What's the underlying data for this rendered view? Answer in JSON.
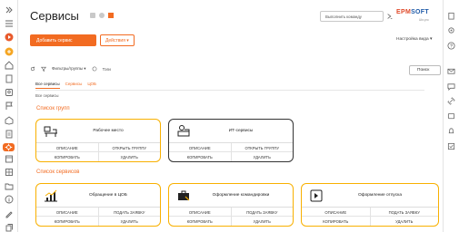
{
  "app": {
    "title": "Сервисы"
  },
  "header": {
    "command_placeholder": "Выполнить команду",
    "logo_main": "EPM",
    "logo_soft": "SOFT",
    "logo_sub": "Ukr-pro"
  },
  "actions": {
    "add_label": "Добавить сервис",
    "actions_label": "Действия ▾",
    "view_label": "Настройка вида ▾"
  },
  "toolbar": {
    "filters_label": "Фильтры/группы ▾",
    "tag_label": "Тэги",
    "search_label": "Поиск"
  },
  "tabs": [
    {
      "label": "Все сервисы",
      "active": true
    },
    {
      "label": "Сервисы",
      "active": false
    },
    {
      "label": "ЦОБ",
      "active": false
    }
  ],
  "breadcrumb": "Все сервисы",
  "sections": {
    "groups": "Список групп",
    "services": "Список сервисов"
  },
  "group_cards": [
    {
      "title": "Рабочее место",
      "icon": "desk-icon",
      "actions": [
        "ОПИСАНИЕ",
        "ОТКРЫТЬ ГРУППУ",
        "КОПИРОВАТЬ",
        "УДАЛИТЬ"
      ]
    },
    {
      "title": "ИТ-сервисы",
      "icon": "it-worker-icon",
      "actions": [
        "ОПИСАНИЕ",
        "ОТКРЫТЬ ГРУППУ",
        "КОПИРОВАТЬ",
        "УДАЛИТЬ"
      ]
    }
  ],
  "service_cards": [
    {
      "title": "Обращение в ЦОБ",
      "icon": "growth-chart-icon",
      "actions": [
        "ОПИСАНИЕ",
        "ПОДАТЬ ЗАЯВКУ",
        "КОПИРОВАТЬ",
        "УДАЛИТЬ"
      ]
    },
    {
      "title": "Оформление командировки",
      "icon": "travel-bag-icon",
      "actions": [
        "ОПИСАНИЕ",
        "ПОДАТЬ ЗАЯВКУ",
        "КОПИРОВАТЬ",
        "УДАЛИТЬ"
      ]
    },
    {
      "title": "Оформление отпуска",
      "icon": "vacation-icon",
      "actions": [
        "ОПИСАНИЕ",
        "ПОДАТЬ ЗАЯВКУ",
        "КОПИРОВАТЬ",
        "УДАЛИТЬ"
      ]
    }
  ],
  "colors": {
    "accent": "#f26b21",
    "card_highlight": "#f8b000"
  }
}
